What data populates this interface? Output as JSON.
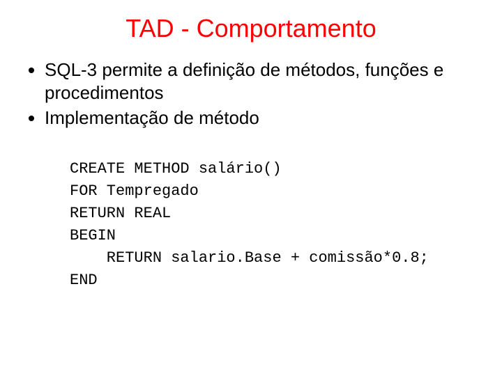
{
  "title": "TAD - Comportamento",
  "bullets": {
    "item1": "SQL-3 permite a definição de métodos, funções e procedimentos",
    "item2": "Implementação de método"
  },
  "code": {
    "l1": "CREATE METHOD salário()",
    "l2": "FOR Tempregado",
    "l3": "RETURN REAL",
    "l4": "BEGIN",
    "l5": "    RETURN salario.Base + comissão*0.8;",
    "l6": "END"
  }
}
